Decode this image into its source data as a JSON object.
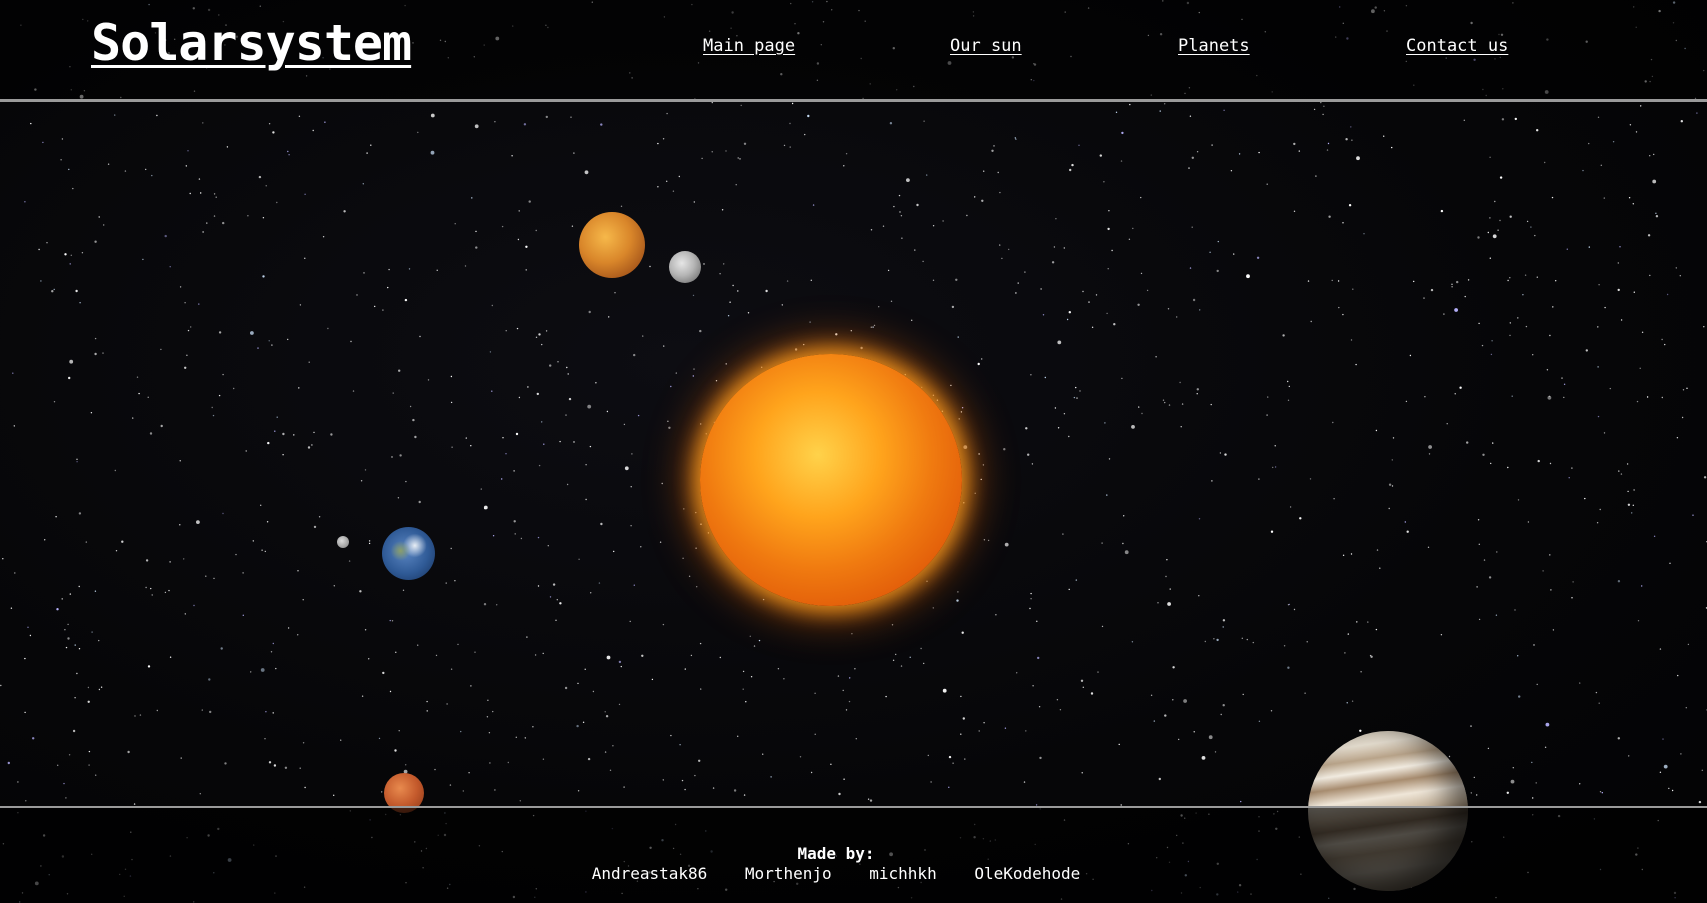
{
  "header": {
    "site_title": "Solarsystem",
    "nav": [
      {
        "label": "Main page"
      },
      {
        "label": "Our sun"
      },
      {
        "label": "Planets"
      },
      {
        "label": "Contact us"
      }
    ]
  },
  "scene": {
    "bodies": [
      "sun",
      "venus",
      "mercury",
      "earth",
      "moon",
      "mars",
      "jupiter"
    ]
  },
  "footer": {
    "title": "Made by:",
    "authors": [
      "Andreastak86",
      "Morthenjo",
      "michhkh",
      "OleKodehode"
    ]
  },
  "colors": {
    "background": "#050505",
    "text": "#ffffff",
    "divider": "#9a9a9a"
  }
}
